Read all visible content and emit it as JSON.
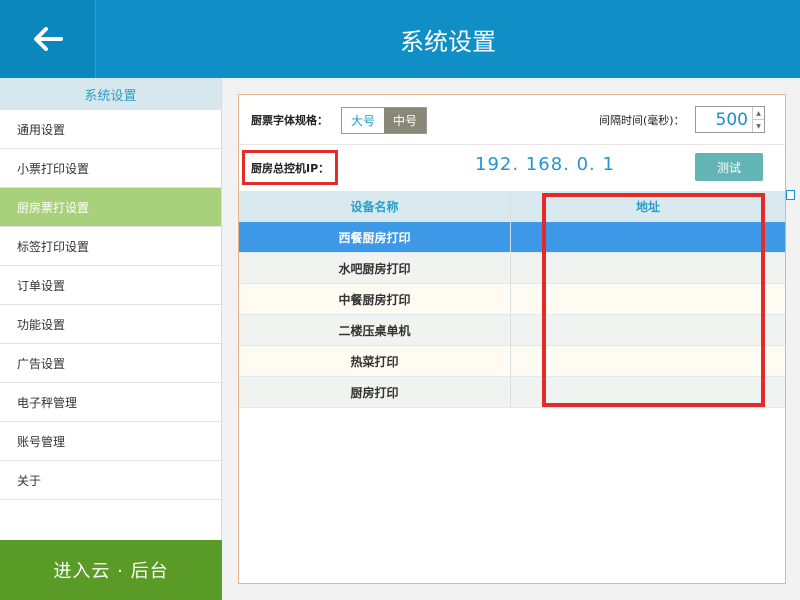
{
  "header": {
    "title": "系统设置",
    "back_icon": "arrow-left-icon"
  },
  "sidebar": {
    "header": "系统设置",
    "items": [
      {
        "label": "通用设置",
        "active": false
      },
      {
        "label": "小票打印设置",
        "active": false
      },
      {
        "label": "厨房票打设置",
        "active": true
      },
      {
        "label": "标签打印设置",
        "active": false
      },
      {
        "label": "订单设置",
        "active": false
      },
      {
        "label": "功能设置",
        "active": false
      },
      {
        "label": "广告设置",
        "active": false
      },
      {
        "label": "电子秤管理",
        "active": false
      },
      {
        "label": "账号管理",
        "active": false
      },
      {
        "label": "关于",
        "active": false
      }
    ],
    "cloud_button": "进入云 · 后台"
  },
  "settings": {
    "font_label": "厨票字体规格：",
    "font_options": [
      "大号",
      "中号"
    ],
    "font_selected": "中号",
    "interval_label": "间隔时间(毫秒)：",
    "interval_value": "500",
    "ip_label": "厨房总控机IP：",
    "ip_value": "192. 168. 0. 1",
    "test_button": "测试"
  },
  "table": {
    "headers": [
      "设备名称",
      "地址"
    ],
    "rows": [
      {
        "name": "西餐厨房打印",
        "address": ""
      },
      {
        "name": "水吧厨房打印",
        "address": ""
      },
      {
        "name": "中餐厨房打印",
        "address": ""
      },
      {
        "name": "二楼压桌单机",
        "address": ""
      },
      {
        "name": "热菜打印",
        "address": ""
      },
      {
        "name": "厨房打印",
        "address": ""
      }
    ],
    "selected_index": 0
  },
  "colors": {
    "header_bg": "#0f8fc6",
    "active_item": "#a9d17b",
    "cloud_button": "#5a9a26",
    "highlight": "#e22b2b",
    "selected_row": "#3d98e8"
  }
}
